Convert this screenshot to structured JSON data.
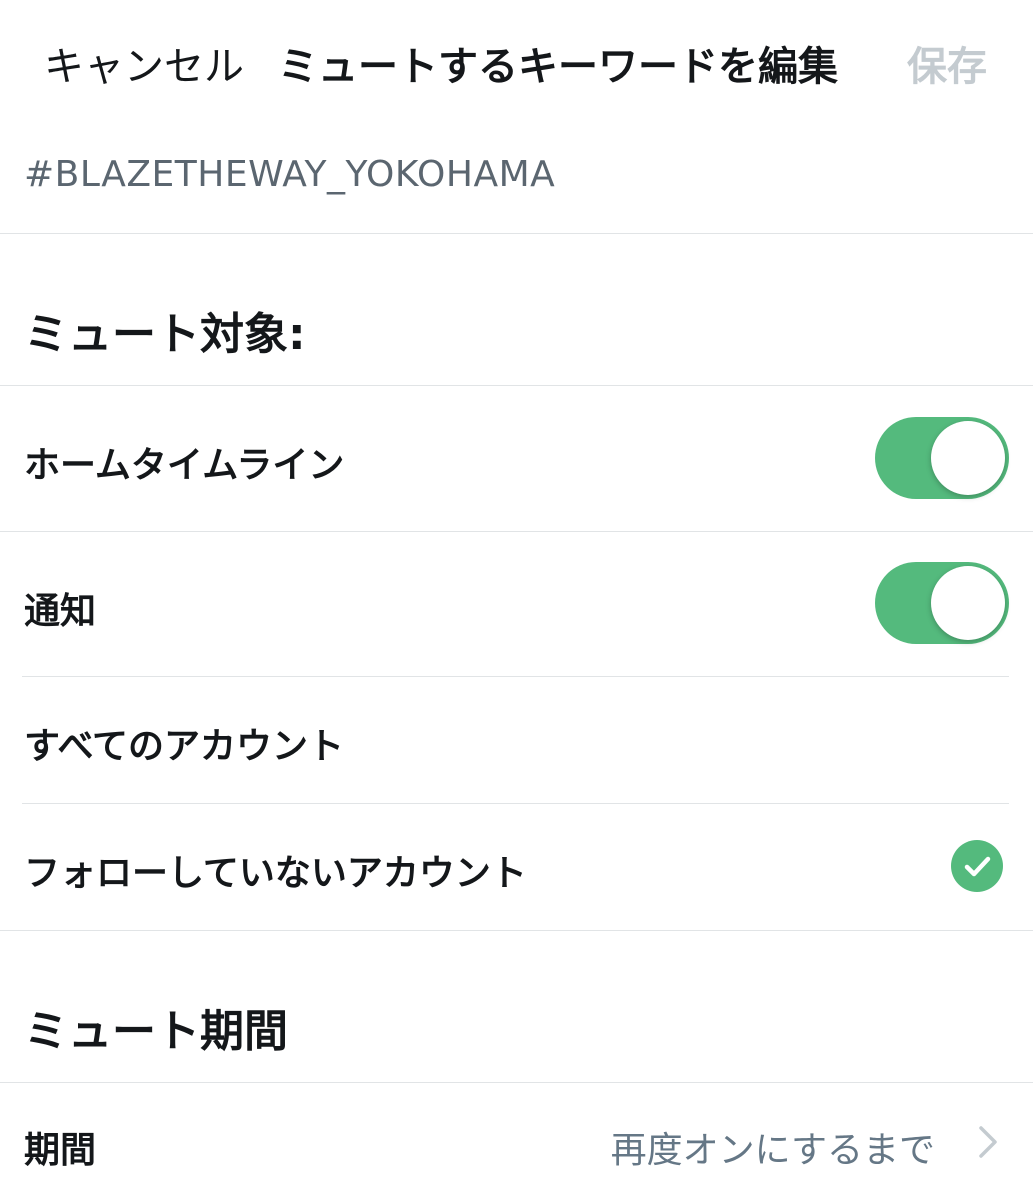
{
  "header": {
    "cancel_label": "キャンセル",
    "title": "ミュートするキーワードを編集",
    "save_label": "保存"
  },
  "keyword": {
    "value": "#BLAZETHEWAY_YOKOHAMA"
  },
  "mute_target": {
    "heading": "ミュート対象:",
    "items": [
      {
        "label": "ホームタイムライン",
        "enabled": true
      },
      {
        "label": "通知",
        "enabled": true
      }
    ]
  },
  "accounts": {
    "options": [
      {
        "label": "すべてのアカウント",
        "selected": false
      },
      {
        "label": "フォローしていないアカウント",
        "selected": true
      }
    ]
  },
  "mute_period": {
    "heading": "ミュート期間",
    "row_label": "期間",
    "row_value": "再度オンにするまで"
  },
  "colors": {
    "accent_green": "#54ba7d",
    "save_disabled": "#c4cbd0",
    "secondary_text": "#657786"
  },
  "icons": {
    "check": "checkmark-icon",
    "chevron": "chevron-right-icon"
  }
}
